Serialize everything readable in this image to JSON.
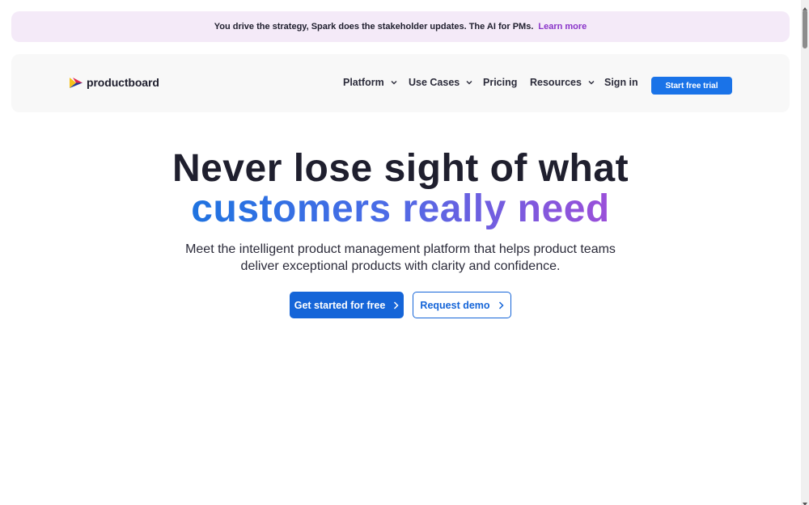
{
  "banner": {
    "message": "You drive the strategy, Spark does the stakeholder updates. The AI for PMs.",
    "link": "Learn more"
  },
  "nav": {
    "logo_text": "productboard",
    "items": [
      {
        "label": "Platform",
        "dropdown": true
      },
      {
        "label": "Use Cases",
        "dropdown": true
      },
      {
        "label": "Pricing",
        "dropdown": false
      },
      {
        "label": "Resources",
        "dropdown": true
      }
    ],
    "sign_in": "Sign in",
    "trial_button": "Start free trial"
  },
  "hero": {
    "line1": "Never lose sight of what",
    "line2": "customers really need",
    "subtitle_line1": "Meet the intelligent product management platform that helps product teams",
    "subtitle_line2": "deliver exceptional products with clarity and confidence.",
    "primary_cta": "Get started for free",
    "secondary_cta": "Request demo"
  },
  "colors": {
    "accent": "#1565d8",
    "banner_bg": "#f4eaf8",
    "banner_link": "#8a35c9",
    "gradient_start": "#1f73e0",
    "gradient_end": "#9b4fd9"
  },
  "icons": {
    "logo": "productboard-logo-icon",
    "dropdown": "chevron-down-icon",
    "cta_arrow": "chevron-right-icon"
  }
}
